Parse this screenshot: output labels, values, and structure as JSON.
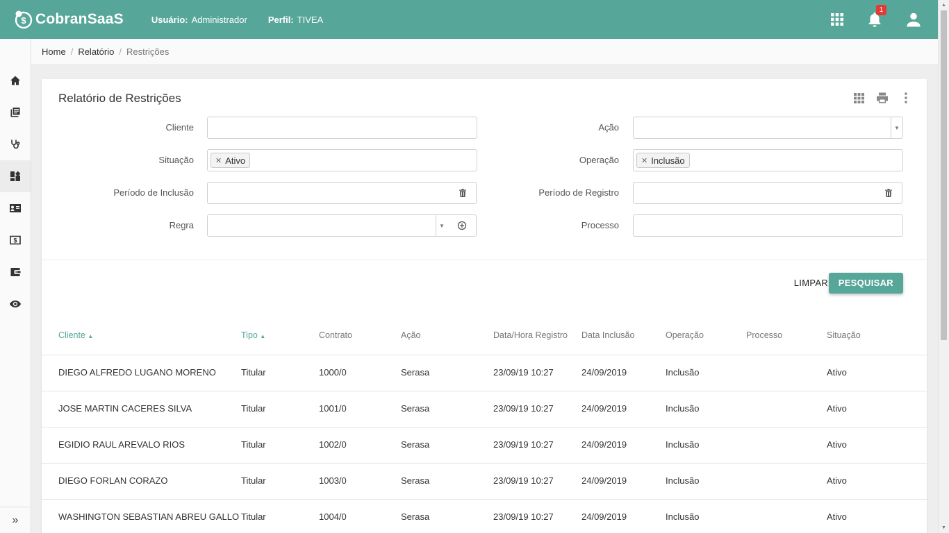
{
  "header": {
    "app_name": "CobranSaaS",
    "user_label": "Usuário:",
    "user_value": "Administrador",
    "profile_label": "Perfil:",
    "profile_value": "TIVEA",
    "notification_count": "1",
    "brand_color": "#56a699",
    "icons": [
      "apps-grid-icon",
      "bell-icon",
      "account-icon"
    ]
  },
  "sidebar": {
    "items": [
      "home-icon",
      "library-books-icon",
      "stethoscope-icon",
      "dashboard-icon",
      "contact-card-icon",
      "money-icon",
      "wallet-icon",
      "eye-icon"
    ],
    "active_index": 3,
    "expand_label": "»"
  },
  "breadcrumb": {
    "items": [
      "Home",
      "Relatório"
    ],
    "current": "Restrições"
  },
  "page": {
    "title": "Relatório de Restrições"
  },
  "filters": {
    "cliente": {
      "label": "Cliente",
      "value": ""
    },
    "acao": {
      "label": "Ação",
      "value": ""
    },
    "situacao": {
      "label": "Situação",
      "chip": "Ativo"
    },
    "operacao": {
      "label": "Operação",
      "chip": "Inclusão"
    },
    "periodo_inclusao": {
      "label": "Período de Inclusão",
      "value": ""
    },
    "periodo_registro": {
      "label": "Período de Registro",
      "value": ""
    },
    "regra": {
      "label": "Regra",
      "value": ""
    },
    "processo": {
      "label": "Processo",
      "value": ""
    }
  },
  "actions": {
    "clear_label": "LIMPAR",
    "search_label": "PESQUISAR"
  },
  "table": {
    "columns": [
      "Cliente",
      "Tipo",
      "Contrato",
      "Ação",
      "Data/Hora Registro",
      "Data Inclusão",
      "Operação",
      "Processo",
      "Situação"
    ],
    "rows": [
      [
        "DIEGO ALFREDO LUGANO MORENO",
        "Titular",
        "1000/0",
        "Serasa",
        "23/09/19 10:27",
        "24/09/2019",
        "Inclusão",
        "",
        "Ativo"
      ],
      [
        "JOSE MARTIN CACERES SILVA",
        "Titular",
        "1001/0",
        "Serasa",
        "23/09/19 10:27",
        "24/09/2019",
        "Inclusão",
        "",
        "Ativo"
      ],
      [
        "EGIDIO RAUL AREVALO RIOS",
        "Titular",
        "1002/0",
        "Serasa",
        "23/09/19 10:27",
        "24/09/2019",
        "Inclusão",
        "",
        "Ativo"
      ],
      [
        "DIEGO FORLAN CORAZO",
        "Titular",
        "1003/0",
        "Serasa",
        "23/09/19 10:27",
        "24/09/2019",
        "Inclusão",
        "",
        "Ativo"
      ],
      [
        "WASHINGTON SEBASTIAN ABREU GALLO",
        "Titular",
        "1004/0",
        "Serasa",
        "23/09/19 10:27",
        "24/09/2019",
        "Inclusão",
        "",
        "Ativo"
      ]
    ]
  }
}
